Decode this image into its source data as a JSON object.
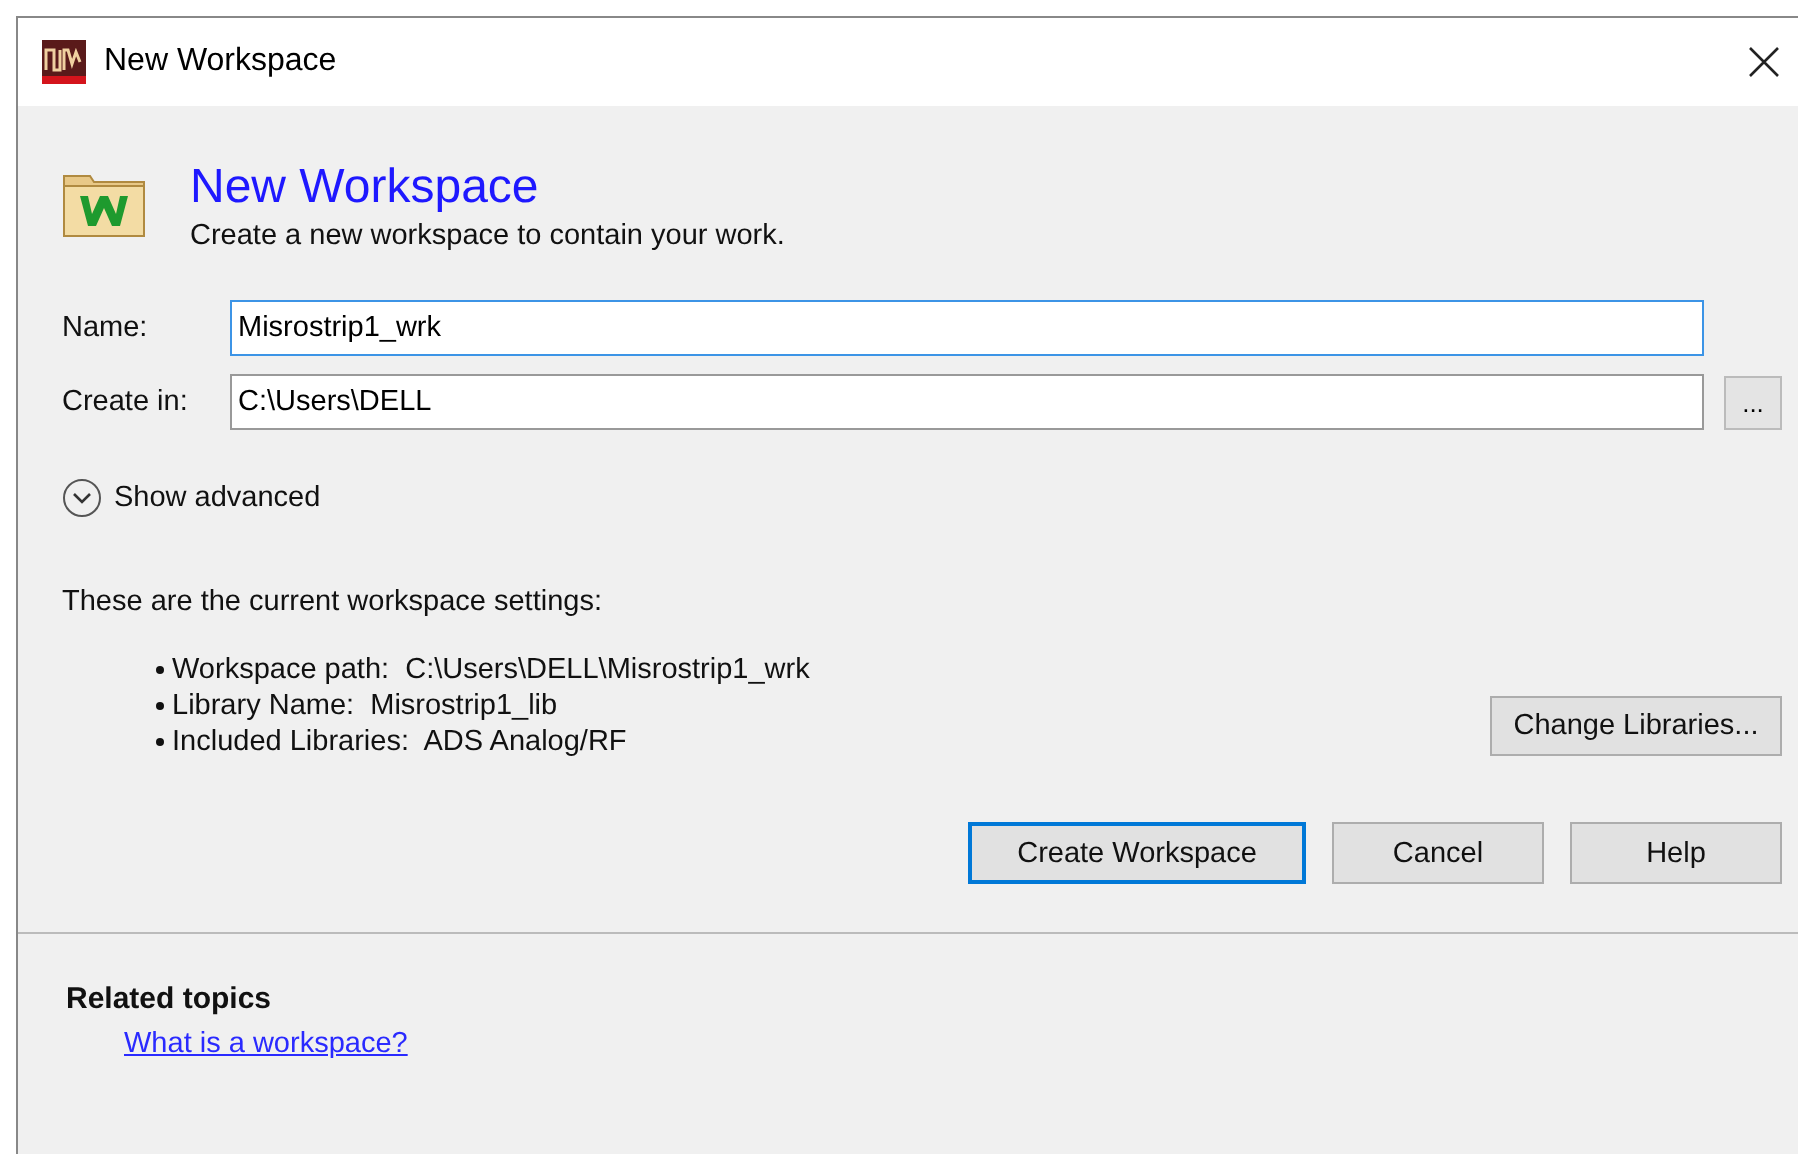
{
  "window": {
    "title": "New Workspace"
  },
  "header": {
    "title": "New Workspace",
    "subtitle": "Create a new workspace to contain your work."
  },
  "fields": [
    {
      "label": "Name:",
      "value": "Misrostrip1_wrk",
      "focused": true
    },
    {
      "label": "Create in:",
      "value": "C:\\Users\\DELL",
      "focused": false,
      "browse": "..."
    }
  ],
  "show_advanced": {
    "label": "Show advanced",
    "expanded": false
  },
  "settings_intro": "These are the current workspace settings:",
  "settings": [
    {
      "label": "Workspace path:",
      "value": "C:\\Users\\DELL\\Misrostrip1_wrk"
    },
    {
      "label": "Library Name:",
      "value": "Misrostrip1_lib"
    },
    {
      "label": "Included Libraries:",
      "value": "ADS Analog/RF"
    }
  ],
  "change_libraries": "Change Libraries...",
  "buttons": [
    {
      "label": "Create Workspace",
      "default": true
    },
    {
      "label": "Cancel",
      "default": false
    },
    {
      "label": "Help",
      "default": false
    }
  ],
  "related": {
    "heading": "Related topics",
    "links": [
      "What is a workspace?"
    ]
  }
}
